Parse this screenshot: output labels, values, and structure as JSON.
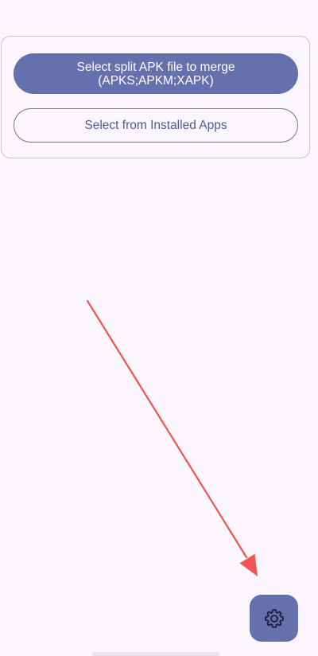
{
  "card": {
    "primary_button": {
      "line1": "Select split APK file to merge",
      "line2": "(APKS;APKM;XAPK)"
    },
    "secondary_button": {
      "label": "Select from Installed Apps"
    }
  },
  "fab": {
    "icon": "gear-icon"
  },
  "colors": {
    "background": "#fbf5fd",
    "primary": "#6571ad",
    "outline_text": "#4d5a98",
    "annotation_arrow": "#f05555"
  }
}
